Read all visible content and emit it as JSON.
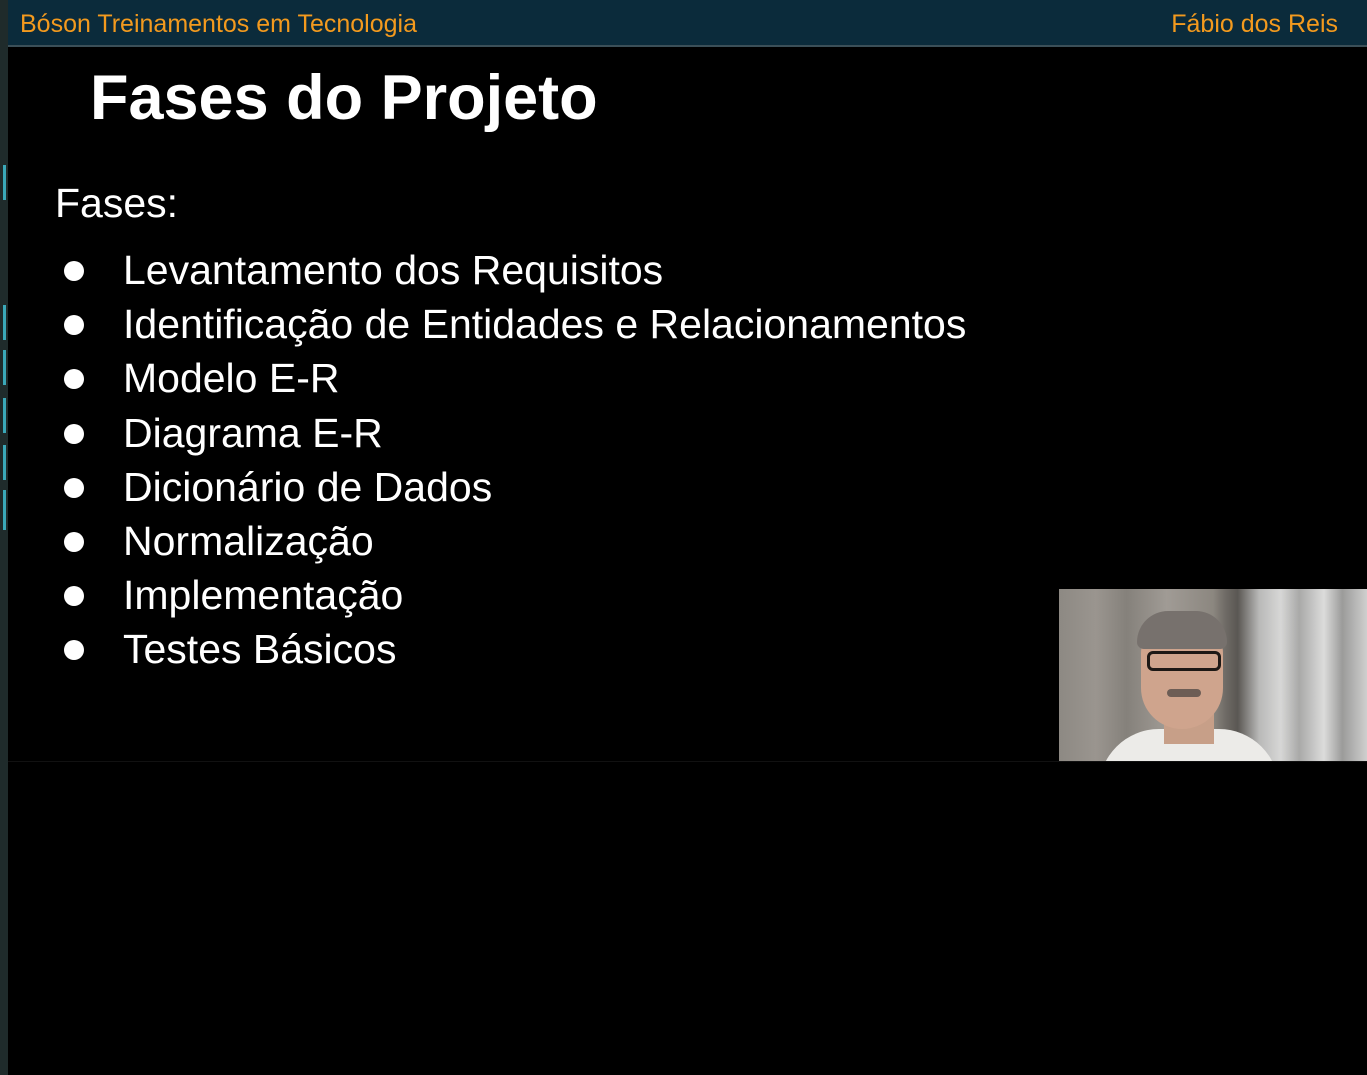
{
  "header": {
    "channel": "Bóson Treinamentos em Tecnologia",
    "author": "Fábio dos Reis"
  },
  "slide": {
    "title": "Fases do Projeto",
    "intro": "Fases:",
    "items": [
      "Levantamento dos Requisitos",
      "Identificação de Entidades e Relacionamentos",
      "Modelo E-R",
      "Diagrama E-R",
      "Dicionário de Dados",
      "Normalização",
      "Implementação",
      "Testes Básicos"
    ]
  },
  "colors": {
    "header_bg": "#0b2b3b",
    "header_text": "#f39a1e",
    "slide_bg": "#000000"
  }
}
